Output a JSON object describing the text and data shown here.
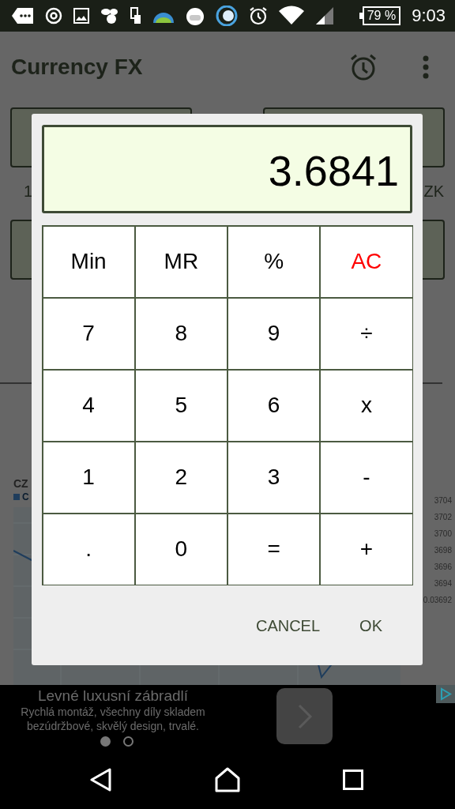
{
  "status_bar": {
    "battery": "79 %",
    "time": "9:03"
  },
  "app_bar": {
    "title": "Currency FX"
  },
  "converter": {
    "amount_label": "1",
    "currency_label": "ZK"
  },
  "chart": {
    "title": "CZ",
    "legend": "C",
    "y_labels": [
      "3704",
      "3702",
      "3700",
      "3698",
      "3696",
      "3694",
      "0.03692"
    ]
  },
  "dialog": {
    "display": "3.6841",
    "keys": [
      {
        "label": "Min",
        "kind": "memory"
      },
      {
        "label": "MR",
        "kind": "memory"
      },
      {
        "label": "%",
        "kind": "operator"
      },
      {
        "label": "AC",
        "kind": "clear"
      },
      {
        "label": "7",
        "kind": "digit"
      },
      {
        "label": "8",
        "kind": "digit"
      },
      {
        "label": "9",
        "kind": "digit"
      },
      {
        "label": "÷",
        "kind": "operator"
      },
      {
        "label": "4",
        "kind": "digit"
      },
      {
        "label": "5",
        "kind": "digit"
      },
      {
        "label": "6",
        "kind": "digit"
      },
      {
        "label": "x",
        "kind": "operator"
      },
      {
        "label": "1",
        "kind": "digit"
      },
      {
        "label": "2",
        "kind": "digit"
      },
      {
        "label": "3",
        "kind": "digit"
      },
      {
        "label": "-",
        "kind": "operator"
      },
      {
        "label": ".",
        "kind": "digit"
      },
      {
        "label": "0",
        "kind": "digit"
      },
      {
        "label": "=",
        "kind": "operator"
      },
      {
        "label": "+",
        "kind": "operator"
      }
    ],
    "buttons": [
      "CANCEL",
      "OK"
    ]
  },
  "ad": {
    "title": "Levné luxusní zábradlí",
    "description": "Rychlá montáž, všechny díly skladem bezúdržbové, skvělý design, trvalé.",
    "pages": [
      {
        "selected": true
      },
      {
        "selected": false
      }
    ]
  }
}
